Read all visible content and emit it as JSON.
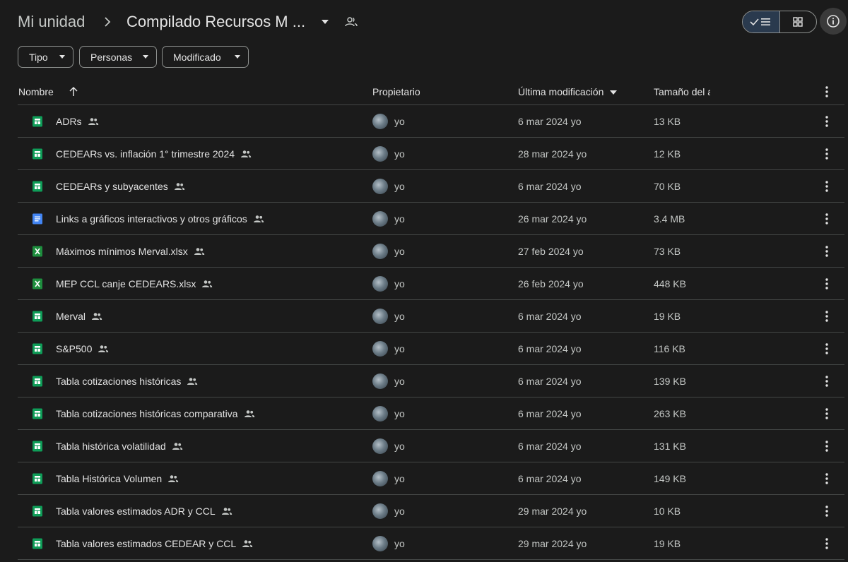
{
  "header": {
    "root_label": "Mi unidad",
    "current_folder": "Compilado Recursos M ..."
  },
  "filters": {
    "tipo": "Tipo",
    "personas": "Personas",
    "modificado": "Modificado"
  },
  "table": {
    "headers": {
      "name": "Nombre",
      "owner": "Propietario",
      "modified": "Última modificación",
      "size": "Tamaño del a"
    },
    "rows": [
      {
        "name": "ADRs",
        "type": "sheets",
        "owner": "yo",
        "modified": "6 mar 2024 yo",
        "size": "13 KB"
      },
      {
        "name": "CEDEARs vs. inflación 1° trimestre 2024",
        "type": "sheets",
        "owner": "yo",
        "modified": "28 mar 2024 yo",
        "size": "12 KB"
      },
      {
        "name": "CEDEARs y subyacentes",
        "type": "sheets",
        "owner": "yo",
        "modified": "6 mar 2024 yo",
        "size": "70 KB"
      },
      {
        "name": "Links a gráficos interactivos y otros gráficos",
        "type": "docs",
        "owner": "yo",
        "modified": "26 mar 2024 yo",
        "size": "3.4 MB"
      },
      {
        "name": "Máximos mínimos Merval.xlsx",
        "type": "excel",
        "owner": "yo",
        "modified": "27 feb 2024 yo",
        "size": "73 KB"
      },
      {
        "name": "MEP CCL canje CEDEARS.xlsx",
        "type": "excel",
        "owner": "yo",
        "modified": "26 feb 2024 yo",
        "size": "448 KB"
      },
      {
        "name": "Merval",
        "type": "sheets",
        "owner": "yo",
        "modified": "6 mar 2024 yo",
        "size": "19 KB"
      },
      {
        "name": "S&P500",
        "type": "sheets",
        "owner": "yo",
        "modified": "6 mar 2024 yo",
        "size": "116 KB"
      },
      {
        "name": "Tabla cotizaciones históricas",
        "type": "sheets",
        "owner": "yo",
        "modified": "6 mar 2024 yo",
        "size": "139 KB"
      },
      {
        "name": "Tabla cotizaciones históricas comparativa",
        "type": "sheets",
        "owner": "yo",
        "modified": "6 mar 2024 yo",
        "size": "263 KB"
      },
      {
        "name": "Tabla histórica volatilidad",
        "type": "sheets",
        "owner": "yo",
        "modified": "6 mar 2024 yo",
        "size": "131 KB"
      },
      {
        "name": "Tabla Histórica Volumen",
        "type": "sheets",
        "owner": "yo",
        "modified": "6 mar 2024 yo",
        "size": "149 KB"
      },
      {
        "name": "Tabla valores estimados ADR y CCL",
        "type": "sheets",
        "owner": "yo",
        "modified": "29 mar 2024 yo",
        "size": "10 KB"
      },
      {
        "name": "Tabla valores estimados CEDEAR y CCL",
        "type": "sheets",
        "owner": "yo",
        "modified": "29 mar 2024 yo",
        "size": "19 KB"
      }
    ]
  },
  "icons": {
    "sheets": "google-sheets-icon",
    "docs": "google-docs-icon",
    "excel": "excel-file-icon",
    "shared": "shared-people-icon",
    "more": "more-vert-icon"
  },
  "colors": {
    "sheets": "#0f9d58",
    "docs": "#4285f4",
    "excel": "#1e8e3e",
    "background": "#1b1b1b"
  }
}
